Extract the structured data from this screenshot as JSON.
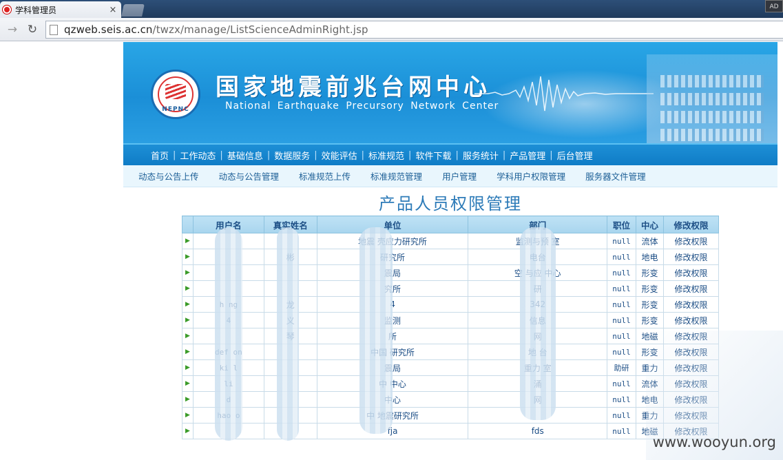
{
  "browser": {
    "tab_title": "学科管理员",
    "tab_close": "×",
    "url_host": "qzweb.seis.ac.cn",
    "url_path": "/twzx/manage/ListScienceAdminRight.jsp",
    "corner_label": "AD"
  },
  "site": {
    "title_cn": "国家地震前兆台网中心",
    "title_en": "National Earthquake Precursory Network Center",
    "logo_text": "NEPNC"
  },
  "main_nav": [
    "首页",
    "工作动态",
    "基础信息",
    "数据服务",
    "效能评估",
    "标准规范",
    "软件下载",
    "服务统计",
    "产品管理",
    "后台管理"
  ],
  "sub_nav": [
    "动态与公告上传",
    "动态与公告管理",
    "标准规范上传",
    "标准规范管理",
    "用户管理",
    "学科用户权限管理",
    "服务器文件管理"
  ],
  "page_title": "产品人员权限管理",
  "table": {
    "headers": [
      "用户名",
      "真实姓名",
      "单位",
      "部门",
      "职位",
      "中心",
      "修改权限"
    ],
    "rows": [
      {
        "username": "",
        "realname": "",
        "unit": "地震   壳应力研究所",
        "dept": "监测与预   室",
        "position": "null",
        "center": "流体",
        "edit": "修改权限"
      },
      {
        "username": "",
        "realname": "彬",
        "unit": "   研究所",
        "dept": "   电台",
        "position": "null",
        "center": "地电",
        "edit": "修改权限"
      },
      {
        "username": "",
        "realname": "",
        "unit": "   震局",
        "dept": "空   与应   中心",
        "position": "null",
        "center": "形变",
        "edit": "修改权限"
      },
      {
        "username": "",
        "realname": "",
        "unit": "   究所",
        "dept": "   研",
        "position": "null",
        "center": "形变",
        "edit": "修改权限"
      },
      {
        "username": "h   ng",
        "realname": "龙",
        "unit": "   4",
        "dept": "   342",
        "position": "null",
        "center": "形变",
        "edit": "修改权限"
      },
      {
        "username": "   4",
        "realname": "义",
        "unit": "   监测",
        "dept": "   信息",
        "position": "null",
        "center": "形变",
        "edit": "修改权限"
      },
      {
        "username": "",
        "realname": "琴",
        "unit": "   所",
        "dept": "   网",
        "position": "null",
        "center": "地磁",
        "edit": "修改权限"
      },
      {
        "username": "def   on",
        "realname": "",
        "unit": "中国   研究所",
        "dept": "地   台",
        "position": "null",
        "center": "形变",
        "edit": "修改权限"
      },
      {
        "username": "ki   l",
        "realname": "",
        "unit": "   震局",
        "dept": "重力   室",
        "position": "助研",
        "center": "重力",
        "edit": "修改权限"
      },
      {
        "username": "li",
        "realname": "",
        "unit": "中   中心",
        "dept": "   涌",
        "position": "null",
        "center": "流体",
        "edit": "修改权限"
      },
      {
        "username": "d",
        "realname": "",
        "unit": "   中心",
        "dept": "   网",
        "position": "null",
        "center": "地电",
        "edit": "修改权限"
      },
      {
        "username": "hao   o",
        "realname": "",
        "unit": "中   地震研究所",
        "dept": "",
        "position": "null",
        "center": "重力",
        "edit": "修改权限"
      },
      {
        "username": "",
        "realname": "",
        "unit": "fja",
        "dept": "fds",
        "position": "null",
        "center": "地磁",
        "edit": "修改权限"
      }
    ]
  },
  "watermark": "www.wooyun.org",
  "colors": {
    "header_blue": "#1b8fd7",
    "nav_blue": "#0f7cc6",
    "link_blue": "#1b4d85",
    "row_arrow": "#3a9b29"
  }
}
